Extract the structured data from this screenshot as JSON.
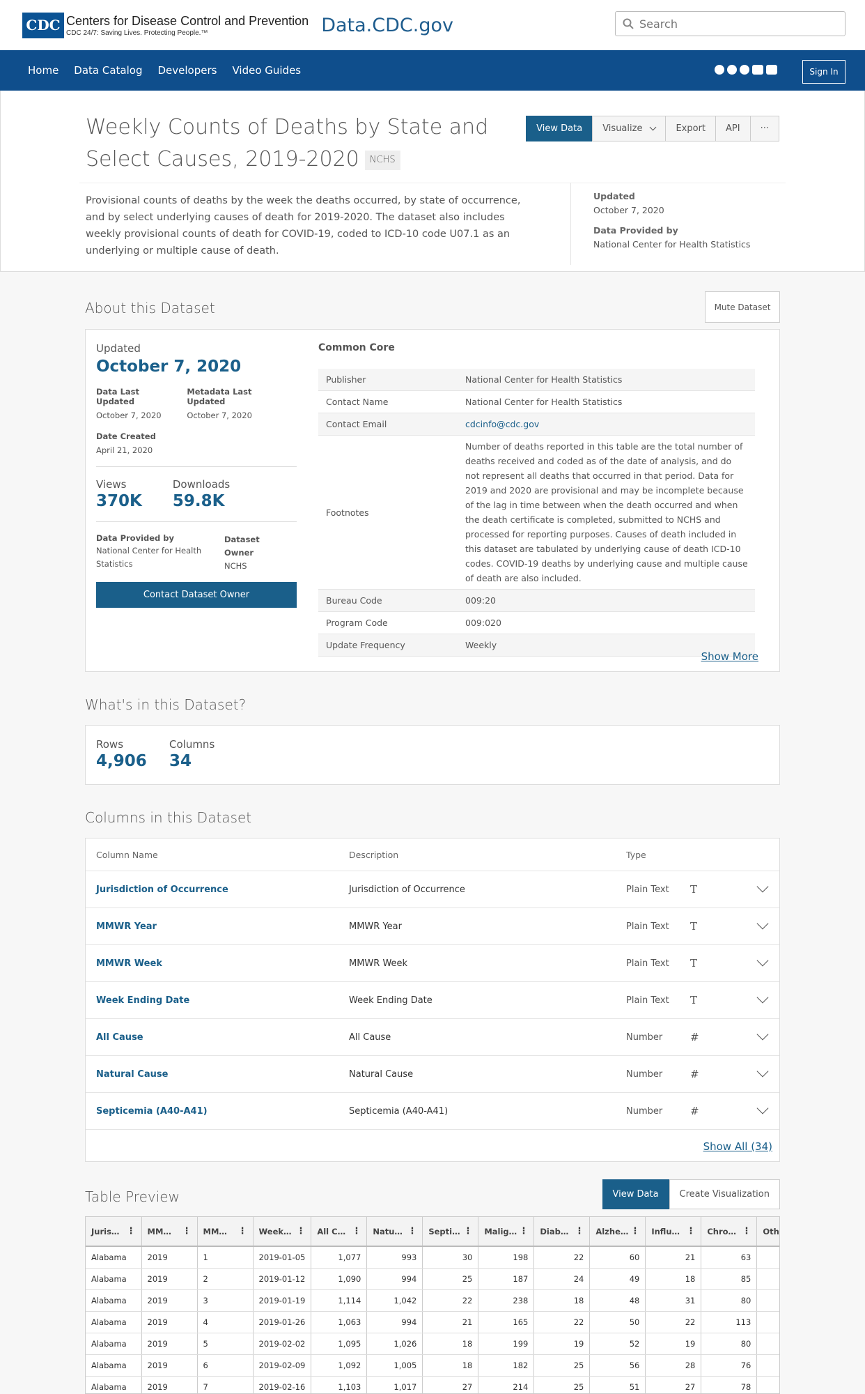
{
  "header": {
    "logo_mark": "CDC",
    "org_name": "Centers for Disease Control and Prevention",
    "tagline": "CDC 24/7: Saving Lives. Protecting People.™",
    "site_name": "Data.CDC.gov",
    "search_placeholder": "Search"
  },
  "nav": {
    "items": [
      "Home",
      "Data Catalog",
      "Developers",
      "Video Guides"
    ],
    "sign_in": "Sign In",
    "social_icons": [
      "facebook-icon",
      "github-icon",
      "twitter-icon",
      "youtube-icon",
      "instagram-icon"
    ]
  },
  "dataset": {
    "title": "Weekly Counts of Deaths by State and Select Causes, 2019-2020",
    "tag": "NCHS",
    "actions": {
      "view_data": "View Data",
      "visualize": "Visualize",
      "export": "Export",
      "api": "API",
      "more": "···"
    },
    "description": "Provisional counts of deaths by the week the deaths occurred, by state of occurrence, and by select underlying causes of death for 2019-2020. The dataset also includes weekly provisional counts of death for COVID-19, coded to ICD-10 code U07.1 as an underlying or multiple cause of death.",
    "updated_label": "Updated",
    "updated_value": "October 7, 2020",
    "provided_label": "Data Provided by",
    "provided_value": "National Center for Health Statistics"
  },
  "about": {
    "section_title": "About this Dataset",
    "mute_label": "Mute Dataset",
    "updated_label": "Updated",
    "updated_value": "October 7, 2020",
    "data_last_updated_label": "Data Last Updated",
    "data_last_updated_value": "October 7, 2020",
    "metadata_last_updated_label": "Metadata Last Updated",
    "metadata_last_updated_value": "October 7, 2020",
    "date_created_label": "Date Created",
    "date_created_value": "April 21, 2020",
    "views_label": "Views",
    "views_value": "370K",
    "downloads_label": "Downloads",
    "downloads_value": "59.8K",
    "provided_by_label": "Data Provided by",
    "provided_by_value": "National Center for Health Statistics",
    "owner_label": "Dataset Owner",
    "owner_value": "NCHS",
    "contact_button": "Contact Dataset Owner",
    "common_core_title": "Common Core",
    "common_core": [
      {
        "key": "Publisher",
        "value": "National Center for Health Statistics"
      },
      {
        "key": "Contact Name",
        "value": "National Center for Health Statistics"
      },
      {
        "key": "Contact Email",
        "value": "cdcinfo@cdc.gov"
      },
      {
        "key": "Footnotes",
        "value": "Number of deaths reported in this table are the total number of deaths received and coded as of the date of analysis, and do not represent all deaths that occurred in that period. Data for 2019 and 2020 are provisional and may be incomplete because of the lag in time between when the death occurred and when the death certificate is completed, submitted to NCHS and processed for reporting purposes. Causes of death included in this dataset are tabulated by underlying cause of death ICD-10 codes. COVID-19 deaths by underlying cause and multiple cause of death are also included."
      },
      {
        "key": "Bureau Code",
        "value": "009:20"
      },
      {
        "key": "Program Code",
        "value": "009:020"
      },
      {
        "key": "Update Frequency",
        "value": "Weekly"
      }
    ],
    "show_more": "Show More"
  },
  "whats": {
    "section_title": "What's in this Dataset?",
    "rows_label": "Rows",
    "rows_value": "4,906",
    "columns_label": "Columns",
    "columns_value": "34"
  },
  "columns": {
    "section_title": "Columns in this Dataset",
    "headers": {
      "name": "Column Name",
      "description": "Description",
      "type": "Type"
    },
    "rows": [
      {
        "name": "Jurisdiction of Occurrence",
        "description": "Jurisdiction of Occurrence",
        "type": "Plain Text",
        "icon": "T"
      },
      {
        "name": "MMWR Year",
        "description": "MMWR Year",
        "type": "Plain Text",
        "icon": "T"
      },
      {
        "name": "MMWR Week",
        "description": "MMWR Week",
        "type": "Plain Text",
        "icon": "T"
      },
      {
        "name": "Week Ending Date",
        "description": "Week Ending Date",
        "type": "Plain Text",
        "icon": "T"
      },
      {
        "name": "All Cause",
        "description": "All Cause",
        "type": "Number",
        "icon": "#"
      },
      {
        "name": "Natural Cause",
        "description": "Natural Cause",
        "type": "Number",
        "icon": "#"
      },
      {
        "name": "Septicemia (A40-A41)",
        "description": "Septicemia (A40-A41)",
        "type": "Number",
        "icon": "#"
      }
    ],
    "show_all": "Show All (34)"
  },
  "preview": {
    "section_title": "Table Preview",
    "view_data": "View Data",
    "create_viz": "Create Visualization",
    "headers": [
      "Juris…",
      "MM…",
      "MM…",
      "Week…",
      "All C…",
      "Natu…",
      "Septi…",
      "Malig…",
      "Diab…",
      "Alzhe…",
      "Influ…",
      "Chro…",
      "Oth"
    ],
    "rows": [
      [
        "Alabama",
        "2019",
        "1",
        "2019-01-05",
        "1,077",
        "993",
        "30",
        "198",
        "22",
        "60",
        "21",
        "63",
        ""
      ],
      [
        "Alabama",
        "2019",
        "2",
        "2019-01-12",
        "1,090",
        "994",
        "25",
        "187",
        "24",
        "49",
        "18",
        "85",
        ""
      ],
      [
        "Alabama",
        "2019",
        "3",
        "2019-01-19",
        "1,114",
        "1,042",
        "22",
        "238",
        "18",
        "48",
        "31",
        "80",
        ""
      ],
      [
        "Alabama",
        "2019",
        "4",
        "2019-01-26",
        "1,063",
        "994",
        "21",
        "165",
        "22",
        "50",
        "22",
        "113",
        ""
      ],
      [
        "Alabama",
        "2019",
        "5",
        "2019-02-02",
        "1,095",
        "1,026",
        "18",
        "199",
        "19",
        "52",
        "19",
        "80",
        ""
      ],
      [
        "Alabama",
        "2019",
        "6",
        "2019-02-09",
        "1,092",
        "1,005",
        "18",
        "182",
        "25",
        "56",
        "28",
        "76",
        ""
      ],
      [
        "Alabama",
        "2019",
        "7",
        "2019-02-16",
        "1,103",
        "1,017",
        "27",
        "214",
        "25",
        "51",
        "27",
        "78",
        ""
      ]
    ]
  }
}
